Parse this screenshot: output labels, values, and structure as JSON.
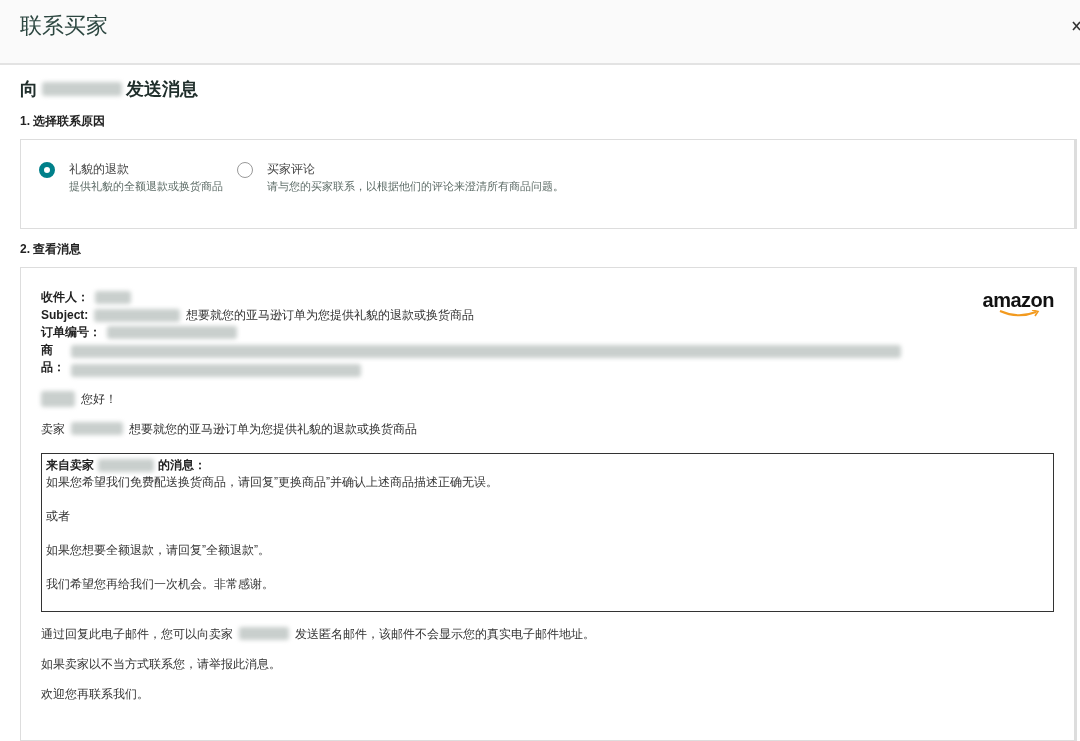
{
  "header": {
    "title": "联系买家"
  },
  "heading": {
    "prefix": "向",
    "suffix": "发送消息"
  },
  "reason_step": {
    "label": "1. 选择联系原因",
    "options": [
      {
        "label": "礼貌的退款",
        "description": "提供礼貌的全额退款或换货商品",
        "selected": true
      },
      {
        "label": "买家评论",
        "description": "请与您的买家联系，以根据他们的评论来澄清所有商品问题。",
        "selected": false
      }
    ]
  },
  "review_step": {
    "label": "2. 查看消息",
    "message": {
      "fields": [
        {
          "kind": "short",
          "label": "收件人："
        },
        {
          "kind": "subject",
          "label": "Subject:",
          "text": "想要就您的亚马逊订单为您提供礼貌的退款或换货商品"
        },
        {
          "kind": "medium",
          "label": "订单编号："
        },
        {
          "kind": "product",
          "label": "商品："
        }
      ],
      "logo": "amazon",
      "greeting": "您好！",
      "intro_prefix": "卖家",
      "intro_text": "想要就您的亚马逊订单为您提供礼貌的退款或换货商品",
      "quote": {
        "title_prefix": "来自卖家",
        "title_suffix": "的消息：",
        "paragraphs": [
          "如果您希望我们免费配送换货商品，请回复”更换商品”并确认上述商品描述正确无误。",
          "或者",
          "如果您想要全额退款，请回复”全额退款”。",
          "我们希望您再给我们一次机会。非常感谢。"
        ]
      },
      "notice_prefix": "通过回复此电子邮件，您可以向卖家",
      "notice_suffix": "发送匿名邮件，该邮件不会显示您的真实电子邮件地址。",
      "closing": [
        "如果卖家以不当方式联系您，请举报此消息。",
        "欢迎您再联系我们。"
      ]
    }
  }
}
